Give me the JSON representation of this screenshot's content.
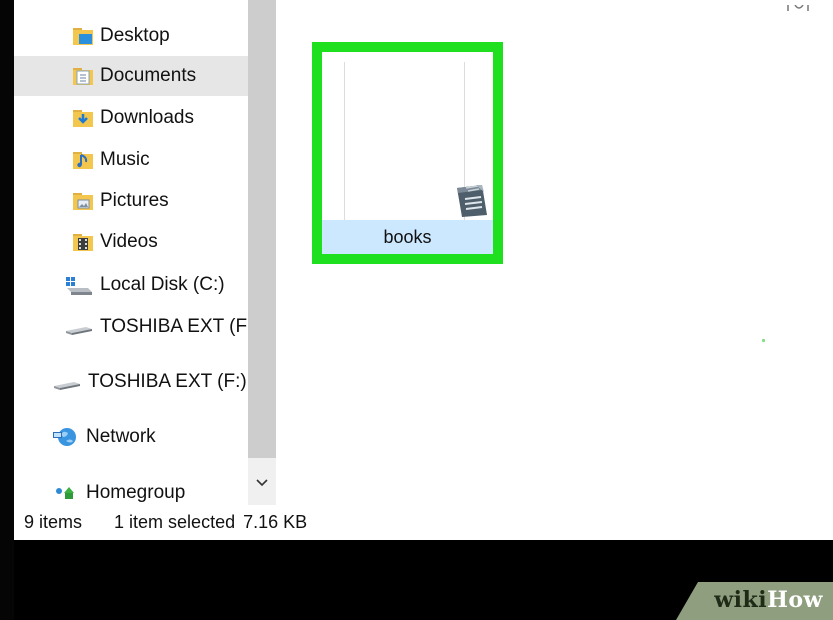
{
  "nav": {
    "items": [
      {
        "label": "Desktop",
        "icon": "desktop-folder-icon"
      },
      {
        "label": "Documents",
        "icon": "documents-folder-icon"
      },
      {
        "label": "Downloads",
        "icon": "downloads-folder-icon"
      },
      {
        "label": "Music",
        "icon": "music-folder-icon"
      },
      {
        "label": "Pictures",
        "icon": "pictures-folder-icon"
      },
      {
        "label": "Videos",
        "icon": "videos-folder-icon"
      },
      {
        "label": "Local Disk (C:)",
        "icon": "local-disk-icon"
      },
      {
        "label": "TOSHIBA EXT (F:",
        "icon": "external-drive-icon"
      },
      {
        "label": "TOSHIBA EXT (F:)",
        "icon": "external-drive-icon"
      },
      {
        "label": "Network",
        "icon": "network-icon"
      },
      {
        "label": "Homegroup",
        "icon": "homegroup-icon"
      }
    ],
    "selected": "Documents"
  },
  "content": {
    "selected_file": {
      "name": "books",
      "icon": "text-document-icon"
    }
  },
  "status": {
    "item_count": "9 items",
    "selection": "1 item selected",
    "size": "7.16 KB"
  },
  "watermark": {
    "wiki": "wiki",
    "how": "How"
  },
  "colors": {
    "highlight_border": "#1fe01f",
    "selection_fill": "#cce8ff",
    "nav_selected": "#e6e6e6",
    "watermark_bg": "#8e9e7e"
  }
}
